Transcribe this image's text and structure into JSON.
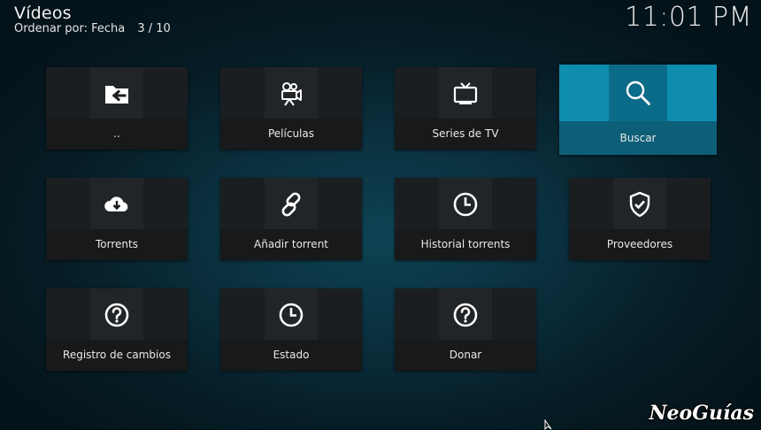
{
  "header": {
    "title": "Vídeos",
    "sort_label": "Ordenar por: Fecha",
    "counter": "3 / 10",
    "clock": "11:01 PM"
  },
  "tiles": [
    {
      "label": "..",
      "icon": "folder-back-icon"
    },
    {
      "label": "Películas",
      "icon": "movie-camera-icon"
    },
    {
      "label": "Series de TV",
      "icon": "tv-icon"
    },
    {
      "label": "Buscar",
      "icon": "search-icon",
      "focused": true
    },
    {
      "label": "Torrents",
      "icon": "cloud-download-icon"
    },
    {
      "label": "Añadir torrent",
      "icon": "link-icon"
    },
    {
      "label": "Historial torrents",
      "icon": "clock-icon"
    },
    {
      "label": "Proveedores",
      "icon": "shield-check-icon"
    },
    {
      "label": "Registro de cambios",
      "icon": "question-icon"
    },
    {
      "label": "Estado",
      "icon": "clock-icon"
    },
    {
      "label": "Donar",
      "icon": "question-icon"
    }
  ],
  "watermark": "NeoGuías",
  "colors": {
    "focus_accent": "#0f8db1",
    "tile_bg": "#1b1e21"
  }
}
